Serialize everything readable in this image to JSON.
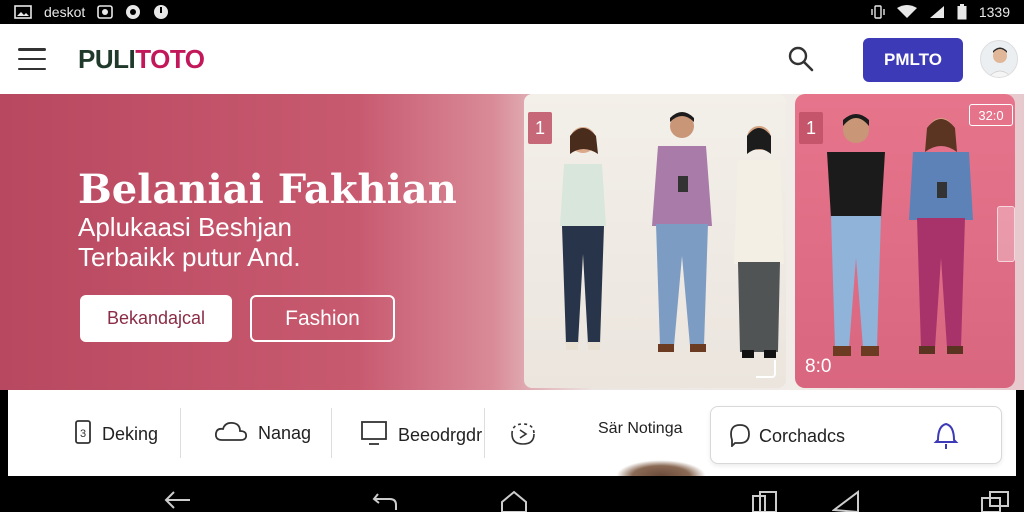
{
  "status_bar": {
    "left_label": "deskot",
    "time": "1339",
    "icons": [
      "image-icon",
      "gallery-icon",
      "circle-icon",
      "record-icon",
      "vibrate-icon",
      "wifi-icon",
      "signal-icon",
      "battery-icon"
    ]
  },
  "app_bar": {
    "logo_part1": "PULI",
    "logo_part2": "TOTO",
    "cta_label": "PMLTO",
    "icons": [
      "menu-icon",
      "search-icon"
    ]
  },
  "hero": {
    "title": "Belaniai Fakhian",
    "subtitle_line1": "Aplukaasi Beshjan",
    "subtitle_line2": "Terbaikk putur And.",
    "primary_button": "Bekandajcal",
    "secondary_button": "Fashion",
    "card1": {
      "badge": "1",
      "corner_label": ""
    },
    "card2": {
      "badge": "1",
      "count": "32:0",
      "number": "8:0"
    }
  },
  "categories": [
    {
      "label": "Deking",
      "icon": "phone-icon"
    },
    {
      "label": "Nanag",
      "icon": "cloud-icon"
    },
    {
      "label": "Beeodrgdr",
      "icon": "monitor-icon"
    },
    {
      "label": "",
      "icon": "refresh-icon"
    },
    {
      "label": "Sär Notinga",
      "icon": ""
    }
  ],
  "featured_category": {
    "label": "Corchadcs",
    "icons": [
      "chat-icon",
      "bell-icon"
    ]
  },
  "nav_bar": {
    "icons": [
      "back-icon",
      "undo-icon",
      "home-icon",
      "recents-icon",
      "send-icon",
      "windows-icon"
    ]
  },
  "colors": {
    "brand_primary": "#3d3ab8",
    "hero_rose": "#c85a70",
    "logo_dark": "#1f3a2b",
    "logo_accent": "#c2185b"
  }
}
